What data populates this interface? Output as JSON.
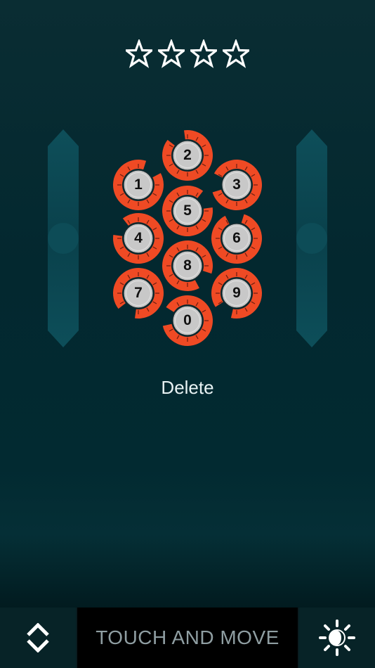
{
  "pin": {
    "entered_digits": 4
  },
  "keypad": {
    "keys": [
      {
        "label": "1"
      },
      {
        "label": "2"
      },
      {
        "label": "3"
      },
      {
        "label": "4"
      },
      {
        "label": "5"
      },
      {
        "label": "6"
      },
      {
        "label": "7"
      },
      {
        "label": "8"
      },
      {
        "label": "9"
      },
      {
        "label": "0"
      }
    ],
    "colors": {
      "ring": "#ef4a24",
      "face": "#c8c8c8",
      "tick": "#6b1d10"
    }
  },
  "delete_label": "Delete",
  "bottom_bar": {
    "hint_label": "TOUCH AND MOVE",
    "mode_icon": "up-down-chevrons-icon",
    "brightness_icon": "brightness-icon"
  },
  "colors": {
    "background": "#022a31",
    "slider": "#0d4a54"
  }
}
